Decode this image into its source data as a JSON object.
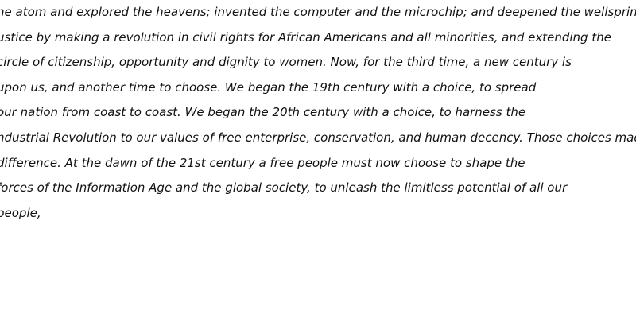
{
  "document": {
    "lines": [
      "he atom and explored the heavens; invented the computer and the microchip; and deepened the wellspring of",
      "ustice by making a revolution in civil rights for African Americans and all minorities, and extending the",
      "circle of citizenship, opportunity and dignity to women. Now, for the third time, a new century is",
      "upon us, and another time to choose. We began the 19th century with a choice, to spread",
      "our nation from coast to coast. We began the 20th century with a choice, to harness the",
      "ndustrial Revolution to our values of free enterprise, conservation, and human decency. Those choices made all the",
      "difference. At the dawn of the 21st century a free people must now choose to shape the",
      "forces of the Information Age and the global society, to unleash the limitless potential of all our",
      "people,"
    ]
  }
}
